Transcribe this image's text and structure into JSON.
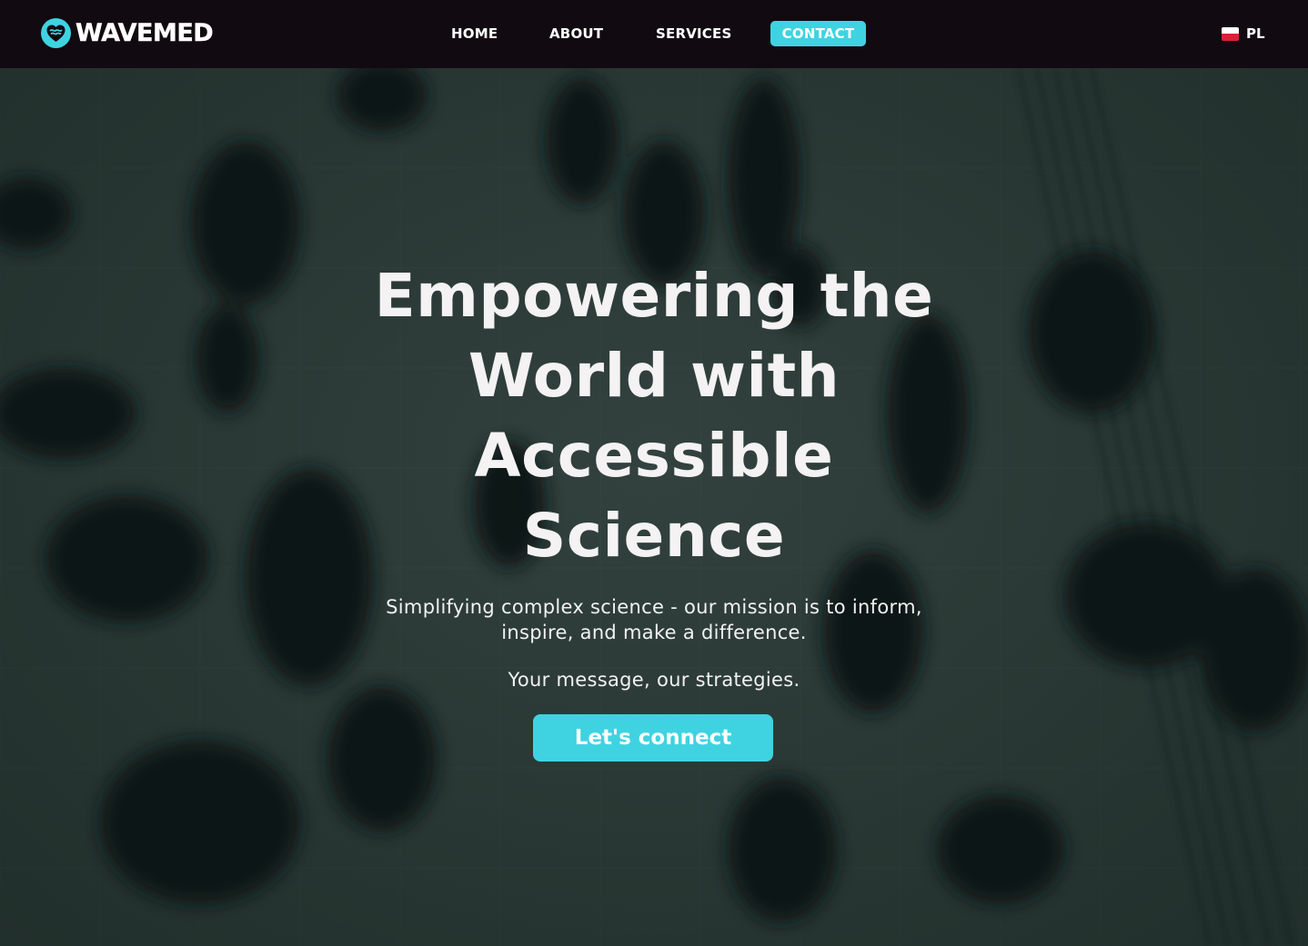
{
  "header": {
    "logo_text": "WAVEMED",
    "logo_icon": "heart-wave-icon",
    "nav": {
      "home": "HOME",
      "about": "ABOUT",
      "services": "SERVICES",
      "contact": "CONTACT"
    },
    "language": {
      "flag_icon": "poland-flag-icon",
      "label": "PL"
    }
  },
  "hero": {
    "title": "Empowering the World with Accessible Science",
    "subtitle": "Simplifying complex science - our mission is to inform, inspire, and make a difference.",
    "tagline": "Your message, our strategies.",
    "cta_label": "Let's connect",
    "background": "blurred-crowd-walking-photo"
  },
  "colors": {
    "accent": "#3fd3e1",
    "header_bg": "#120a11",
    "hero_tint": "#2c3a37",
    "text": "#f4f2f2"
  }
}
